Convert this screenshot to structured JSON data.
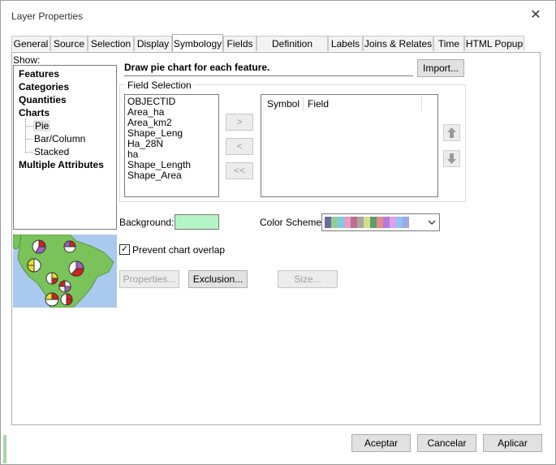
{
  "window": {
    "title": "Layer Properties",
    "close_symbol": "✕"
  },
  "tabs": [
    {
      "label": "General"
    },
    {
      "label": "Source"
    },
    {
      "label": "Selection"
    },
    {
      "label": "Display"
    },
    {
      "label": "Symbology",
      "active": true
    },
    {
      "label": "Fields"
    },
    {
      "label": "Definition Query"
    },
    {
      "label": "Labels"
    },
    {
      "label": "Joins & Relates"
    },
    {
      "label": "Time"
    },
    {
      "label": "HTML Popup"
    }
  ],
  "show": {
    "label": "Show:",
    "items": [
      {
        "label": "Features",
        "bold": true
      },
      {
        "label": "Categories",
        "bold": true
      },
      {
        "label": "Quantities",
        "bold": true
      },
      {
        "label": "Charts",
        "bold": true
      },
      {
        "label": "Pie",
        "selected": true
      },
      {
        "label": "Bar/Column"
      },
      {
        "label": "Stacked"
      },
      {
        "label": "Multiple Attributes",
        "bold": true
      }
    ]
  },
  "description": "Draw pie chart for each feature.",
  "import_label": "Import...",
  "field_selection": {
    "label": "Field Selection",
    "fields": [
      "OBJECTID",
      "Area_ha",
      "Area_km2",
      "Shape_Leng",
      "Ha_28N",
      "ha",
      "Shape_Length",
      "Shape_Area"
    ],
    "move_buttons": [
      ">",
      "<",
      "<<"
    ],
    "columns": [
      "Symbol",
      "Field"
    ],
    "up_icon": "up-arrow-icon",
    "down_icon": "down-arrow-icon"
  },
  "background": {
    "label": "Background:",
    "color": "#b4f5c8"
  },
  "color_scheme": {
    "label": "Color  Scheme:",
    "colors": [
      "#6b6b9e",
      "#8ed18e",
      "#80c8e6",
      "#e6a0c4",
      "#c46b8e",
      "#a6a6a6",
      "#d6e08a",
      "#5a9e6b",
      "#e68a8a",
      "#b07ae0",
      "#e0a0e6",
      "#8ac4f0",
      "#a0a8e6"
    ]
  },
  "prevent_overlap": {
    "label": "Prevent chart overlap",
    "checked": true,
    "mark": "✓"
  },
  "buttons": {
    "properties": "Properties...",
    "exclusion": "Exclusion...",
    "size": "Size..."
  },
  "footer": {
    "ok": "Aceptar",
    "cancel": "Cancelar",
    "apply": "Aplicar"
  }
}
